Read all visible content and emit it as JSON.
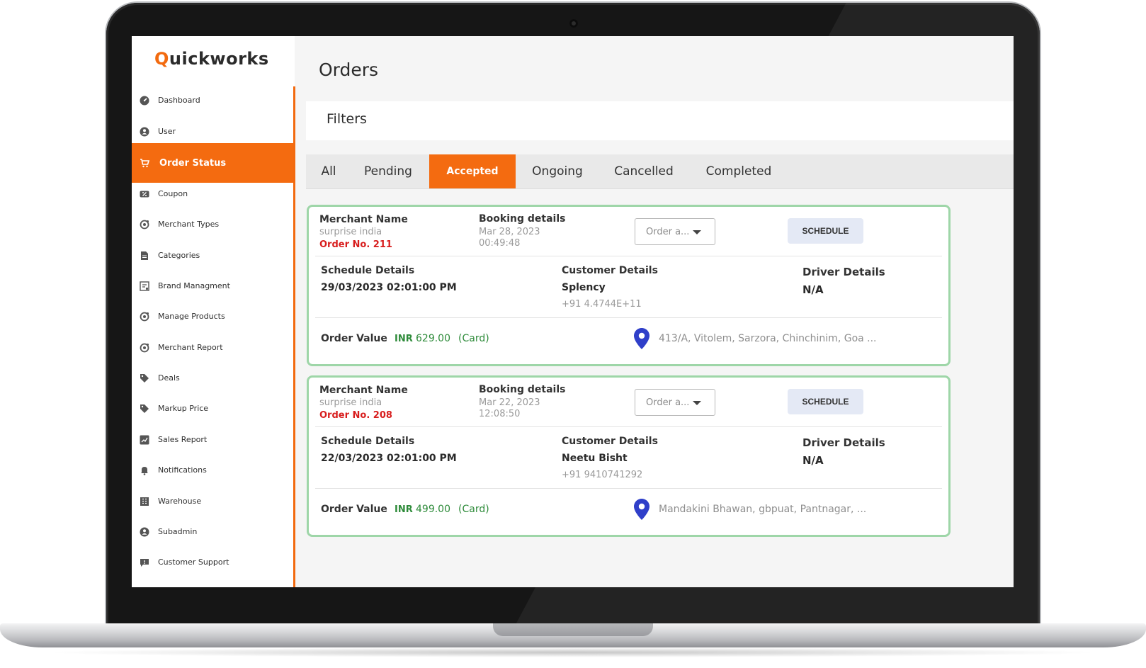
{
  "app": {
    "logo_first": "Q",
    "logo_rest": "uickworks",
    "brand_color": "#f46b10"
  },
  "sidebar": {
    "items": [
      {
        "label": "Dashboard",
        "icon": "dashboard-icon"
      },
      {
        "label": "User",
        "icon": "user-icon"
      },
      {
        "label": "Order Status",
        "icon": "cart-icon",
        "active": true
      },
      {
        "label": "Coupon",
        "icon": "coupon-icon"
      },
      {
        "label": "Merchant Types",
        "icon": "merchant-icon"
      },
      {
        "label": "Categories",
        "icon": "categories-icon"
      },
      {
        "label": "Brand Managment",
        "icon": "brand-icon"
      },
      {
        "label": "Manage Products",
        "icon": "products-icon"
      },
      {
        "label": "Merchant Report",
        "icon": "report-icon"
      },
      {
        "label": "Deals",
        "icon": "tag-icon"
      },
      {
        "label": "Markup Price",
        "icon": "price-tag-icon"
      },
      {
        "label": "Sales Report",
        "icon": "chart-icon"
      },
      {
        "label": "Notifications",
        "icon": "bell-icon"
      },
      {
        "label": "Warehouse",
        "icon": "warehouse-icon"
      },
      {
        "label": "Subadmin",
        "icon": "subadmin-icon"
      },
      {
        "label": "Customer Support",
        "icon": "chat-icon"
      }
    ]
  },
  "main": {
    "title": "Orders",
    "filters_label": "Filters",
    "tabs": [
      {
        "label": "All"
      },
      {
        "label": "Pending"
      },
      {
        "label": "Accepted",
        "active": true
      },
      {
        "label": "Ongoing"
      },
      {
        "label": "Cancelled"
      },
      {
        "label": "Completed"
      }
    ],
    "orders": [
      {
        "merchant_label": "Merchant Name",
        "merchant_name": "surprise india",
        "order_no": "Order No. 211",
        "booking_label": "Booking details",
        "booking_date": "Mar 28, 2023",
        "booking_time": "00:49:48",
        "select_value": "Order a...",
        "schedule_button": "SCHEDULE",
        "schedule_label": "Schedule Details",
        "schedule_value": "29/03/2023 02:01:00 PM",
        "customer_label": "Customer Details",
        "customer_name": "Splency",
        "customer_phone": "+91 4.4744E+11",
        "driver_label": "Driver Details",
        "driver_value": "N/A",
        "order_value_label": "Order Value",
        "currency": "INR",
        "amount": "629.00",
        "payment": "(Card)",
        "address": "413/A, Vitolem, Sarzora, Chinchinim, Goa ..."
      },
      {
        "merchant_label": "Merchant Name",
        "merchant_name": "surprise india",
        "order_no": "Order No. 208",
        "booking_label": "Booking details",
        "booking_date": "Mar 22, 2023",
        "booking_time": "12:08:50",
        "select_value": "Order a...",
        "schedule_button": "SCHEDULE",
        "schedule_label": "Schedule Details",
        "schedule_value": "22/03/2023 02:01:00 PM",
        "customer_label": "Customer Details",
        "customer_name": "Neetu Bisht",
        "customer_phone": "+91 9410741292",
        "driver_label": "Driver Details",
        "driver_value": "N/A",
        "order_value_label": "Order Value",
        "currency": "INR",
        "amount": "499.00",
        "payment": "(Card)",
        "address": "Mandakini Bhawan, gbpuat, Pantnagar, ..."
      }
    ]
  }
}
